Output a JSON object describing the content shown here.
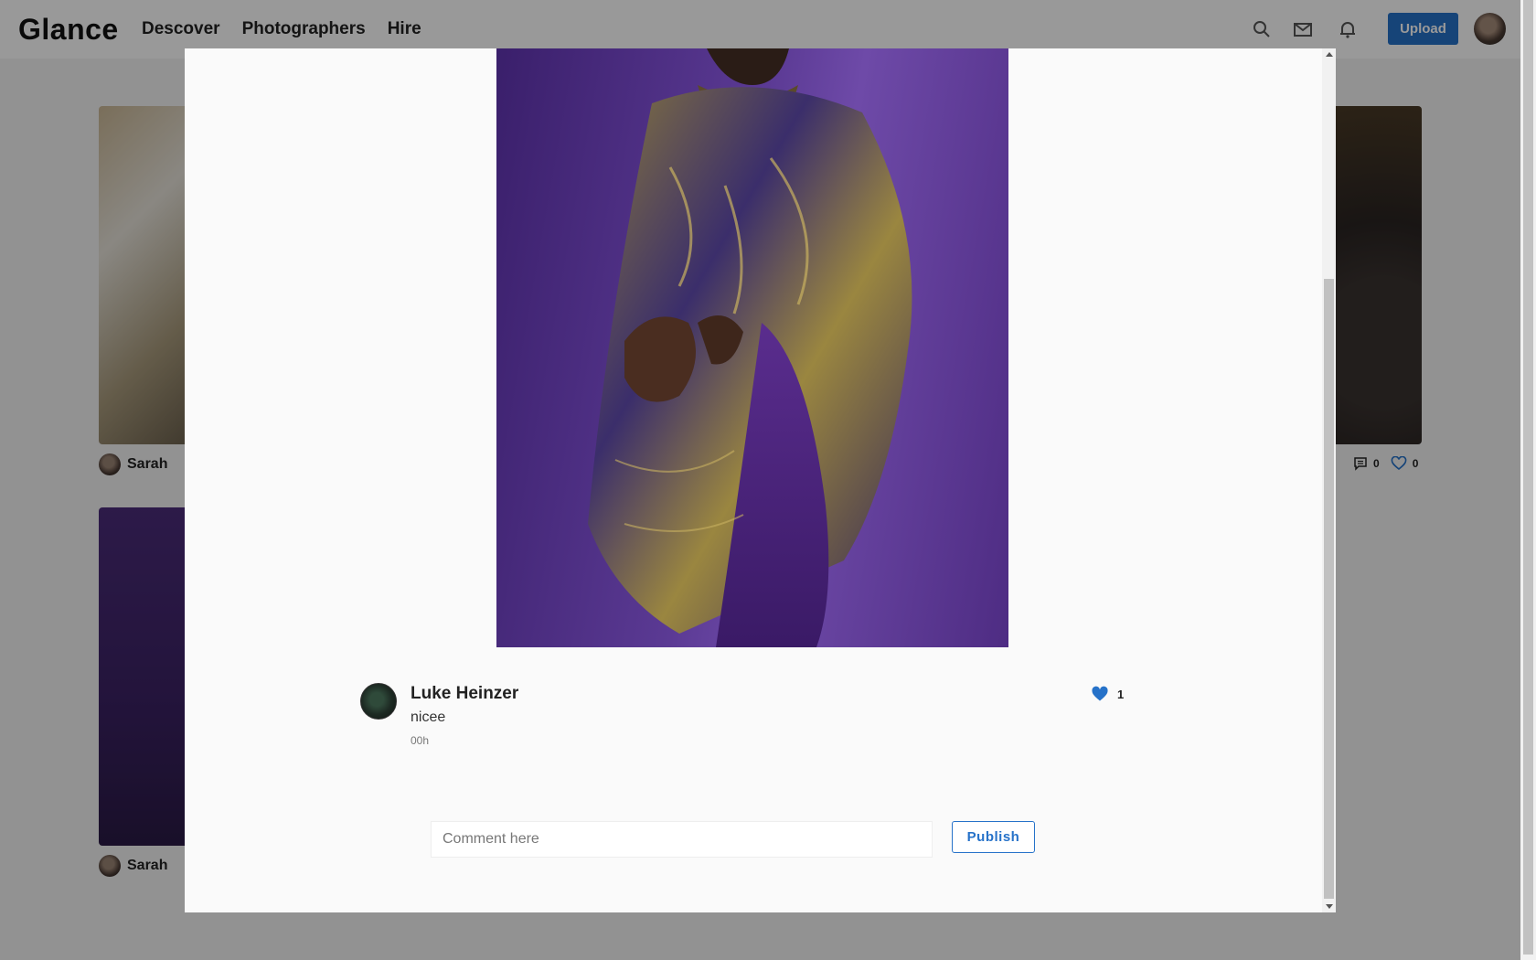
{
  "app": {
    "logo": "Glance"
  },
  "nav": {
    "items": [
      "Descover",
      "Photographers",
      "Hire"
    ]
  },
  "header": {
    "upload_label": "Upload"
  },
  "gallery": {
    "cards": [
      {
        "author": "Sarah"
      },
      {
        "author": "Sarah"
      }
    ],
    "card_right_stats": {
      "comments": "0",
      "likes": "0"
    }
  },
  "modal": {
    "comment": {
      "author": "Luke Heinzer",
      "text": "nicee",
      "time": "00h",
      "likes": "1"
    },
    "input_placeholder": "Comment here",
    "publish_label": "Publish"
  },
  "colors": {
    "accent": "#2672c9",
    "photo_bg": "#5b3a94"
  }
}
